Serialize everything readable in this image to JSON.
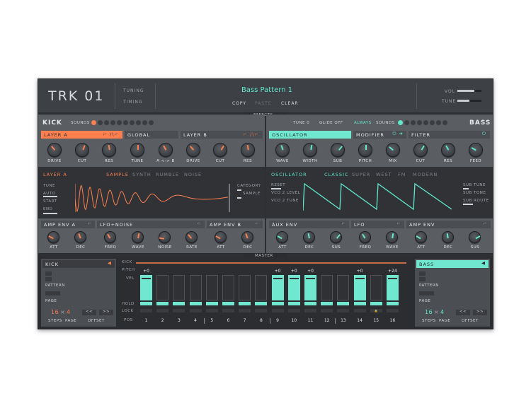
{
  "header": {
    "logo": "TRK 01",
    "tuning_label": "TUNING",
    "timing_label": "TIMING",
    "preset_name": "Bass Pattern 1",
    "copy_label": "COPY",
    "paste_label": "PASTE",
    "clear_label": "CLEAR",
    "vol_label": "VOL",
    "tune_label": "TUNE"
  },
  "effects_label": "EFFECTS",
  "master_label": "MASTER",
  "kick": {
    "title": "KICK",
    "sounds_label": "SOUNDS",
    "layer_a": "LAYER A",
    "global": "GLOBAL",
    "layer_b": "LAYER B",
    "knobs_a": [
      "DRIVE",
      "CUT",
      "RES"
    ],
    "knobs_g": [
      "TUNE",
      "A <-> B"
    ],
    "knobs_b": [
      "DRIVE",
      "CUT",
      "RES"
    ],
    "layer_label": "LAYER A",
    "tabs": [
      "SAMPLE",
      "SYNTH",
      "RUMBLE",
      "NOISE"
    ],
    "params": [
      "TUNE",
      "AUTO",
      "START",
      "END"
    ],
    "category_label": "CATEGORY",
    "sample_label": "SAMPLE",
    "env_amp_a": "AMP ENV A",
    "env_lfo": "LFO+NOISE",
    "env_amp_b": "AMP ENV B",
    "env_knobs_a": [
      "ATT",
      "DEC"
    ],
    "env_knobs_lfo": [
      "FREQ",
      "WAVE",
      "NOISE",
      "RATE"
    ],
    "env_knobs_b": [
      "ATT",
      "DEC"
    ]
  },
  "bass": {
    "title": "BASS",
    "tune_label": "TUNE 0",
    "glide_label": "GLIDE OFF",
    "always_label": "ALWAYS",
    "sounds_label": "SOUNDS",
    "oscillator": "OSCILLATOR",
    "modifier": "MODIFIER",
    "filter": "FILTER",
    "knobs_osc": [
      "WAVE",
      "WIDTH",
      "SUB"
    ],
    "knobs_mod": [
      "PITCH",
      "MIX"
    ],
    "knobs_filter": [
      "CUT",
      "RES",
      "FEED"
    ],
    "osc_label": "OSCILLATOR",
    "tabs": [
      "CLASSIC",
      "SUPER",
      "WEST",
      "FM",
      "MODERN"
    ],
    "params": [
      "RESET",
      "VCO 2 LEVEL",
      "VCO 2 TUNE"
    ],
    "right_params": [
      "SUB TUNE",
      "SUB TONE",
      "SUB ROUTE"
    ],
    "env_aux": "AUX ENV",
    "env_lfo": "LFO",
    "env_amp": "AMP ENV",
    "env_knobs_aux": [
      "ATT",
      "DEC",
      "SUS"
    ],
    "env_knobs_lfo": [
      "FREQ",
      "WAVE"
    ],
    "env_knobs_amp": [
      "ATT",
      "DEC",
      "SUS"
    ]
  },
  "seq_left": {
    "title": "KICK",
    "pattern_label": "PATTERN",
    "page_label": "PAGE",
    "steps_value": "16",
    "page_value": "4",
    "steps_label": "STEPS",
    "page_label2": "PAGE",
    "offset_label": "OFFSET",
    "offset_btns": [
      "<<",
      ">>"
    ]
  },
  "seq_right": {
    "title": "BASS",
    "pattern_label": "PATTERN",
    "page_label": "PAGE",
    "steps_value": "16",
    "page_value": "4",
    "steps_label": "STEPS",
    "page_label2": "PAGE",
    "offset_label": "OFFSET",
    "offset_btns": [
      "<<",
      ">>"
    ]
  },
  "seq": {
    "row_labels": [
      "KICK",
      "PITCH",
      "VEL",
      "HOLD",
      "LOCK",
      "POS"
    ],
    "steps": [
      "1",
      "2",
      "3",
      "4",
      "5",
      "6",
      "7",
      "8",
      "9",
      "10",
      "11",
      "12",
      "13",
      "14",
      "15",
      "16"
    ],
    "pitch": [
      "+0",
      "",
      "",
      "",
      "",
      "",
      "",
      "",
      "+0",
      "+0",
      "+0",
      "",
      "",
      "+0",
      "",
      "+24"
    ],
    "active": [
      true,
      false,
      false,
      false,
      false,
      false,
      false,
      false,
      true,
      true,
      true,
      false,
      false,
      true,
      false,
      true
    ],
    "velocity": [
      0.9,
      0,
      0,
      0,
      0,
      0,
      0,
      0,
      0.9,
      0.9,
      0.9,
      0,
      0,
      0.9,
      0,
      0.9
    ]
  },
  "colors": {
    "orange": "#ff7f4f",
    "teal": "#5fe8cc"
  }
}
